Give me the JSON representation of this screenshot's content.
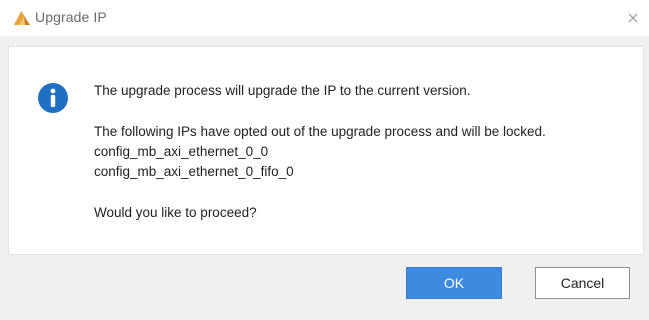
{
  "window": {
    "title": "Upgrade IP",
    "app_icon": "vivado-logo-icon",
    "close_icon": "close-icon"
  },
  "message": {
    "icon": "info-icon",
    "line1": "The upgrade process will upgrade the IP to the current version.",
    "line2": "The following IPs have opted out of the upgrade process and will be locked.",
    "locked_ips": [
      "config_mb_axi_ethernet_0_0",
      "config_mb_axi_ethernet_0_fifo_0"
    ],
    "question": "Would you like to proceed?"
  },
  "buttons": {
    "ok_label": "OK",
    "cancel_label": "Cancel"
  },
  "colors": {
    "accent": "#3d8ae0",
    "info_icon": "#1f6fc5"
  }
}
